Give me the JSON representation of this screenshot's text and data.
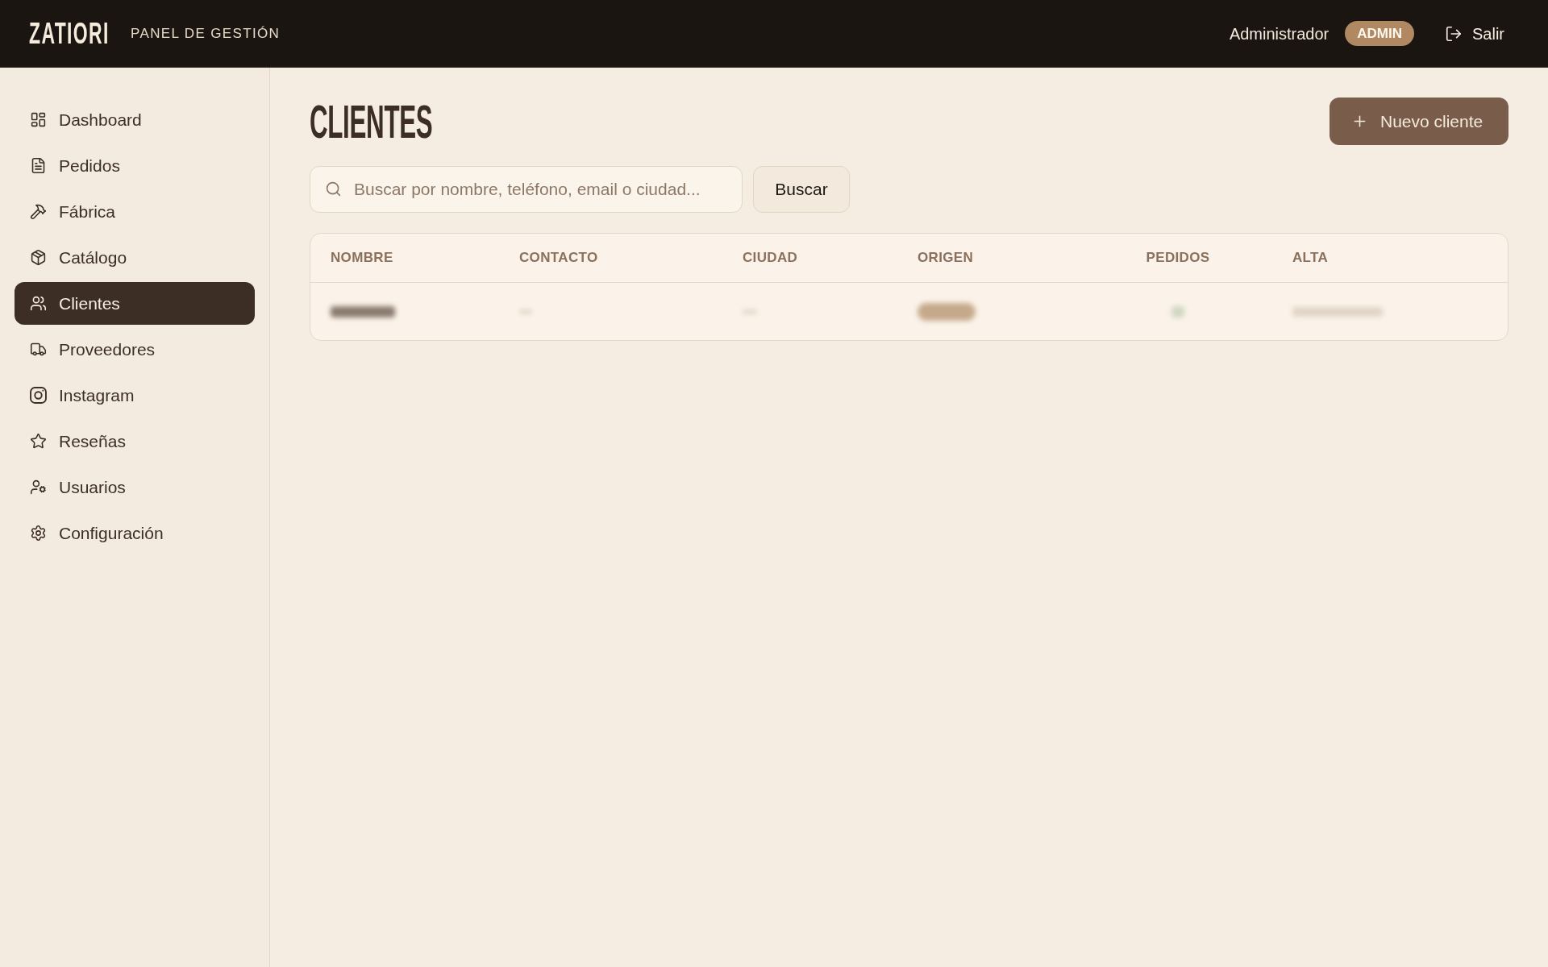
{
  "header": {
    "logo": "ZATIORI",
    "subtitle": "PANEL DE GESTIÓN",
    "user_name": "Administrador",
    "role_badge": "ADMIN",
    "logout": "Salir"
  },
  "sidebar": {
    "items": [
      {
        "label": "Dashboard",
        "selected": false
      },
      {
        "label": "Pedidos",
        "selected": false
      },
      {
        "label": "Fábrica",
        "selected": false
      },
      {
        "label": "Catálogo",
        "selected": false
      },
      {
        "label": "Clientes",
        "selected": true
      },
      {
        "label": "Proveedores",
        "selected": false
      },
      {
        "label": "Instagram",
        "selected": false
      },
      {
        "label": "Reseñas",
        "selected": false
      },
      {
        "label": "Usuarios",
        "selected": false
      },
      {
        "label": "Configuración",
        "selected": false
      }
    ]
  },
  "page": {
    "title": "CLIENTES",
    "new_button": "Nuevo cliente",
    "search": {
      "placeholder": "Buscar por nombre, teléfono, email o ciudad..."
    },
    "search_button": "Buscar"
  },
  "table": {
    "columns": [
      "NOMBRE",
      "CONTACTO",
      "CIUDAD",
      "ORIGEN",
      "PEDIDOS",
      "ALTA"
    ],
    "rows": [
      {
        "redacted": true
      }
    ]
  }
}
